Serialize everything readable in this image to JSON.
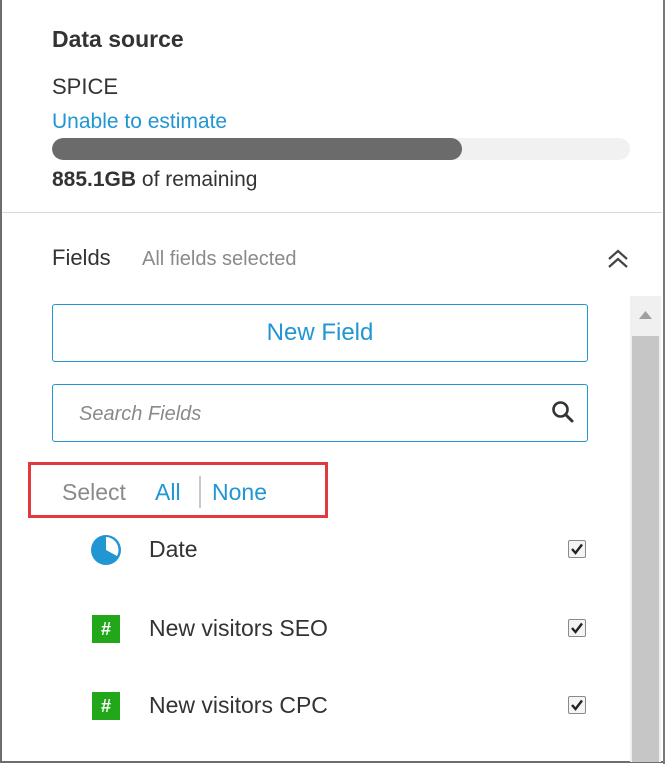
{
  "data_source": {
    "title": "Data source",
    "type": "SPICE",
    "estimate_link": "Unable to estimate",
    "usage_fraction": 0.71,
    "remaining_amount": "885.1GB",
    "remaining_suffix": " of remaining"
  },
  "fields": {
    "label": "Fields",
    "status": "All fields selected",
    "collapse_icon": "double-chevron-up-icon",
    "new_field_label": "New Field",
    "search_placeholder": "Search Fields",
    "search_value": "",
    "select_label": "Select",
    "select_all": "All",
    "select_none": "None",
    "items": [
      {
        "name": "Date",
        "type": "date",
        "icon": "clock-icon",
        "checked": true
      },
      {
        "name": "New visitors SEO",
        "type": "numeric",
        "icon": "#",
        "checked": true
      },
      {
        "name": "New visitors CPC",
        "type": "numeric",
        "icon": "#",
        "checked": true
      }
    ]
  },
  "colors": {
    "accent": "#2196d3",
    "numeric_badge": "#22a71a",
    "highlight": "#e0393e",
    "usage_bar": "#6b6b6b"
  }
}
